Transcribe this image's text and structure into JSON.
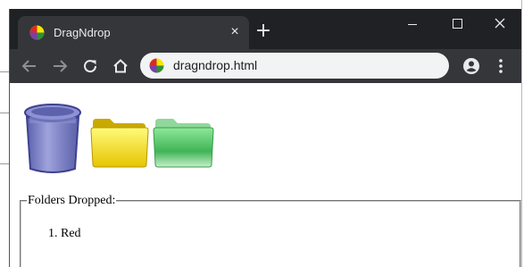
{
  "browser": {
    "tab_title": "DragNdrop",
    "tab_close_glyph": "×",
    "new_tab_glyph": "+",
    "url": "dragndrop.html",
    "colors": {
      "titlebar": "#202124",
      "tab": "#35363a",
      "omnibox": "#f1f3f4"
    },
    "icons": [
      "favicon-icon",
      "back-arrow-icon",
      "forward-arrow-icon",
      "reload-icon",
      "home-icon",
      "profile-icon",
      "kebab-menu-icon",
      "minimize-icon",
      "maximize-icon",
      "close-icon"
    ]
  },
  "page": {
    "icons": [
      "trash-can-icon",
      "yellow-folder-icon",
      "green-folder-icon"
    ],
    "folder_colors": {
      "yellow": "#f2e600",
      "green": "#55c26a",
      "trash": "#7b80c8"
    },
    "dropped_legend": "Folders Dropped:",
    "dropped_items": [
      "Red"
    ]
  }
}
